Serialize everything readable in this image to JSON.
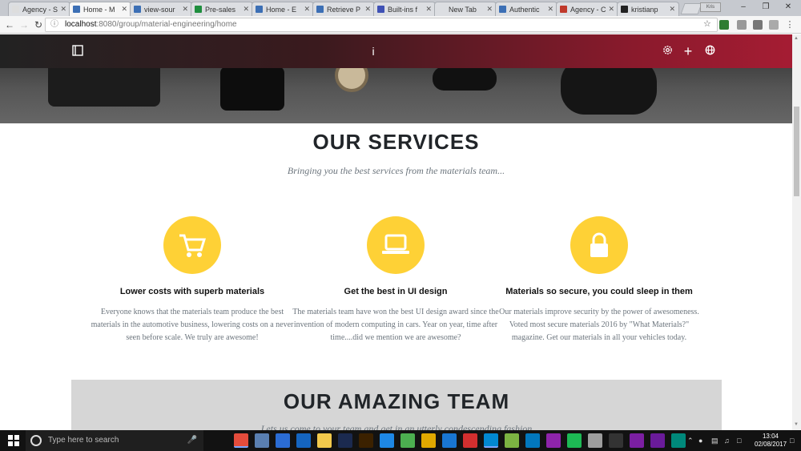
{
  "browser": {
    "tabs": [
      {
        "label": "Agency - S",
        "active": false,
        "icon": "page-icon"
      },
      {
        "label": "Home - M",
        "active": true,
        "icon": "site-icon"
      },
      {
        "label": "view-sour",
        "active": false,
        "icon": "site-icon"
      },
      {
        "label": "Pre-sales",
        "active": false,
        "icon": "sheets-icon"
      },
      {
        "label": "Home - E",
        "active": false,
        "icon": "site-icon"
      },
      {
        "label": "Retrieve P",
        "active": false,
        "icon": "site-icon"
      },
      {
        "label": "Built-ins f",
        "active": false,
        "icon": "builtins-icon"
      },
      {
        "label": "New Tab",
        "active": false,
        "icon": "none"
      },
      {
        "label": "Authentic",
        "active": false,
        "icon": "site-icon"
      },
      {
        "label": "Agency - C",
        "active": false,
        "icon": "s-icon"
      },
      {
        "label": "kristianp",
        "active": false,
        "icon": "github-icon"
      }
    ],
    "profile_label": "Kris",
    "url_host": "localhost",
    "url_rest": ":8080/group/material-engineering/home"
  },
  "page": {
    "services": {
      "title": "OUR SERVICES",
      "subtitle": "Bringing you the best services from the materials team...",
      "items": [
        {
          "icon": "shopping-cart-icon",
          "heading": "Lower costs with superb materials",
          "text": "Everyone knows that the materials team produce the best materials in the automotive business, lowering costs on a never seen before scale. We truly are awesome!"
        },
        {
          "icon": "laptop-icon",
          "heading": "Get the best in UI design",
          "text": "The materials team have won the best UI design award since the invention of modern computing in cars. Year on year, time after time....did we mention we are awesome?"
        },
        {
          "icon": "lock-icon",
          "heading": "Materials so secure, you could sleep in them",
          "text": "Our materials improve security by the power of awesomeness. Voted most secure materials 2016 by \"What Materials?\" magazine. Get our materials in all your vehicles today."
        }
      ]
    },
    "team": {
      "title": "OUR AMAZING TEAM",
      "subtitle": "Lets us come to your team and get in an utterly condescending fashion"
    },
    "navbar": {
      "center_icon": "i"
    }
  },
  "taskbar": {
    "search_placeholder": "Type here to search",
    "time": "13:04",
    "date": "02/08/2017"
  },
  "colors": {
    "accent": "#fed136",
    "navbar_end": "#a51c33"
  }
}
